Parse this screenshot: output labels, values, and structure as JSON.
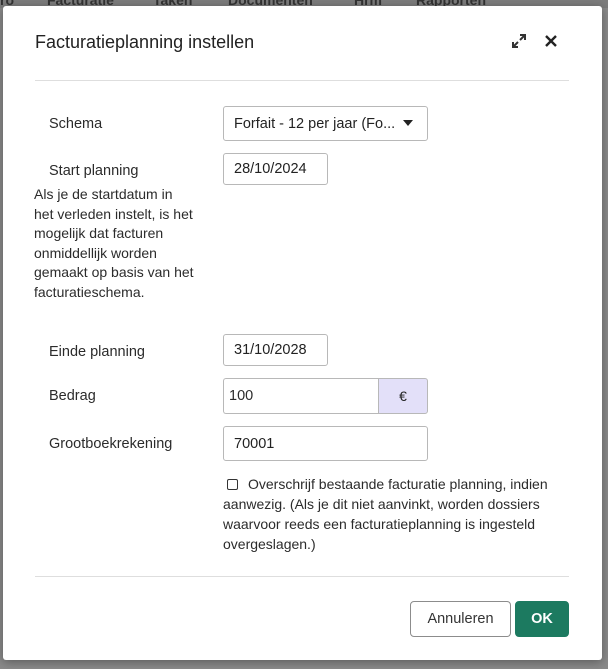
{
  "background": {
    "nav_items": [
      "ro",
      "Facturatie",
      "Taken",
      "Documenten",
      "Hrm",
      "Rapporten"
    ]
  },
  "dialog": {
    "title": "Facturatieplanning instellen",
    "icons": {
      "expand": "expand-icon",
      "close": "close-icon"
    },
    "fields": {
      "schema": {
        "label": "Schema",
        "value": "Forfait - 12 per jaar (Fo..."
      },
      "start": {
        "label": "Start planning",
        "value": "28/10/2024",
        "help": "Als je de startdatum in het verleden instelt, is het mogelijk dat facturen onmiddellijk worden gemaakt op basis van het facturatieschema."
      },
      "end": {
        "label": "Einde planning",
        "value": "31/10/2028"
      },
      "amount": {
        "label": "Bedrag",
        "value": "100",
        "currency": "€"
      },
      "ledger": {
        "label": "Grootboekrekening",
        "value": "70001"
      }
    },
    "overwrite": {
      "checked": false,
      "text": "Overschrijf bestaande facturatie planning, indien aanwezig. (Als je dit niet aanvinkt, worden dossiers waarvoor reeds een facturatieplanning is ingesteld overgeslagen.)"
    },
    "buttons": {
      "cancel": "Annuleren",
      "ok": "OK"
    },
    "colors": {
      "primary": "#1c7a60",
      "addon": "#e3e0f9"
    }
  }
}
